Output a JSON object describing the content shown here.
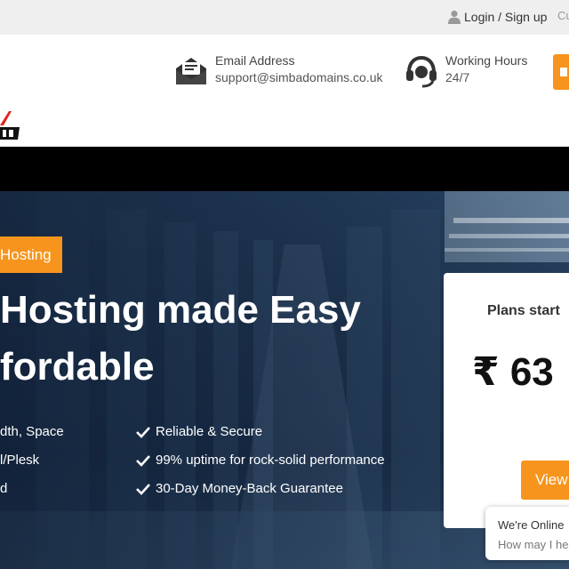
{
  "topbar": {
    "login_label": "Login / Sign up",
    "currency_partial": "Cu",
    "icons": {
      "user": "user-icon"
    }
  },
  "header": {
    "email": {
      "title": "Email Address",
      "value": "support@simbadomains.co.uk",
      "icon": "email-icon"
    },
    "hours": {
      "title": "Working Hours",
      "value": "24/7",
      "icon": "headset-icon"
    },
    "logo_alt": "Simba Domains logo"
  },
  "hero": {
    "badge": "Hosting",
    "title_line1": "Hosting made Easy",
    "title_line2": "fordable",
    "features_left": [
      "dth, Space",
      "l/Plesk",
      "d"
    ],
    "features_right": [
      "Reliable & Secure",
      "99% uptime for rock-solid performance",
      "30-Day Money-Back Guarantee"
    ]
  },
  "plan": {
    "label": "Plans start",
    "price": "₹ 63",
    "button": "View"
  },
  "chat": {
    "line1": "We're Online",
    "line2": "How may I he"
  },
  "colors": {
    "accent": "#f7941d",
    "nav": "#000000",
    "topbar": "#efefef",
    "hero_overlay": "#0d1c32"
  }
}
